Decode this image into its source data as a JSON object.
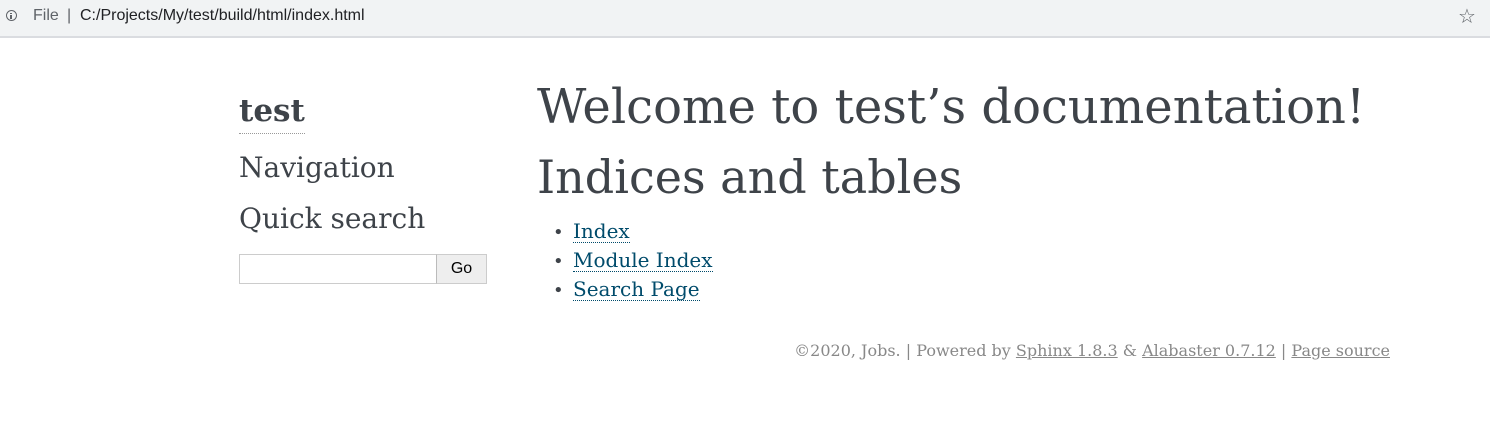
{
  "browser": {
    "scheme_label": "File",
    "divider": "|",
    "url": "C:/Projects/My/test/build/html/index.html"
  },
  "sidebar": {
    "project_name": "test",
    "navigation_heading": "Navigation",
    "search_heading": "Quick search",
    "search_value": "",
    "go_label": "Go"
  },
  "main": {
    "title": "Welcome to test’s documentation!",
    "subtitle": "Indices and tables",
    "links": [
      {
        "label": "Index"
      },
      {
        "label": "Module Index"
      },
      {
        "label": "Search Page"
      }
    ]
  },
  "footer": {
    "copyright": "©2020, Jobs. | Powered by ",
    "sphinx_label": "Sphinx 1.8.3",
    "amp": " & ",
    "alabaster_label": "Alabaster 0.7.12",
    "sep": " | ",
    "page_source_label": "Page source"
  },
  "colors": {
    "text": "#3e4349",
    "link": "#004b6b",
    "footer": "#888888",
    "addr_bar_bg": "#f1f3f4"
  }
}
